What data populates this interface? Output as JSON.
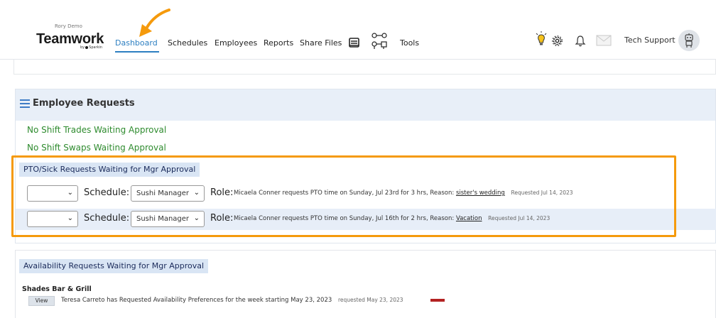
{
  "header": {
    "company_name": "Rory Demo",
    "logo_text": "Teamwork",
    "logo_byline": "by",
    "logo_byline_brand": "Sparkin",
    "nav": [
      {
        "label": "Dashboard",
        "active": true
      },
      {
        "label": "Schedules"
      },
      {
        "label": "Employees"
      },
      {
        "label": "Reports"
      },
      {
        "label": "Share Files"
      },
      {
        "label": "Tools"
      }
    ],
    "user_name": "Tech Support",
    "icons": [
      "lightbulb-icon",
      "gear-icon",
      "bell-icon",
      "mail-icon",
      "robot-avatar-icon",
      "document-icon",
      "org-chart-icon"
    ]
  },
  "employee_requests": {
    "title": "Employee Requests",
    "no_trades": "No Shift Trades Waiting Approval",
    "no_swaps": "No Shift Swaps Waiting Approval",
    "pto_section_title": "PTO/Sick Requests Waiting for Mgr Approval",
    "schedule_label": "Schedule:",
    "role_label": "Role:",
    "requested_prefix": "Requested",
    "rows": [
      {
        "status_value": "",
        "schedule_value": "Sushi Manager",
        "text": "Micaela Conner requests PTO time on Sunday, Jul 23rd for 3 hrs, Reason:",
        "reason": "sister's wedding",
        "requested": "Requested Jul 14, 2023"
      },
      {
        "status_value": "",
        "schedule_value": "Sushi Manager",
        "text": "Micaela Conner requests PTO time on Sunday, Jul 16th for 2 hrs, Reason:",
        "reason": "Vacation",
        "requested": "Requested Jul 14, 2023"
      }
    ]
  },
  "availability": {
    "section_title": "Availability Requests Waiting for Mgr Approval",
    "store_name": "Shades Bar & Grill",
    "view_label": "View",
    "text": "Teresa Carreto has Requested Availability Preferences for the week starting May 23, 2023",
    "requested": "requested May 23, 2023"
  },
  "colors": {
    "accent": "#2d7fc1",
    "highlight": "#f59a0c",
    "success_text": "#2e8b2e",
    "section_bg": "#d9e5f4",
    "header_bg": "#e8eff8",
    "alert_bar": "#b32222"
  }
}
